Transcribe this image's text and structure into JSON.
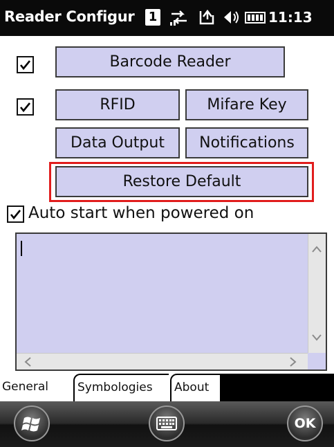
{
  "window": {
    "title": "Reader Configur",
    "badge": "1",
    "clock": "11:13",
    "status_icons": [
      "connectivity-icon",
      "sync-icon",
      "volume-icon",
      "battery-icon"
    ]
  },
  "buttons": {
    "barcode_reader": "Barcode Reader",
    "rfid": "RFID",
    "mifare_key": "Mifare Key",
    "data_output": "Data Output",
    "notifications": "Notifications",
    "restore_default": "Restore Default"
  },
  "checkboxes": {
    "barcode_enabled": true,
    "rfid_enabled": true,
    "auto_start_checked": true,
    "auto_start_label": "Auto start when powered on"
  },
  "log_area": {
    "value": ""
  },
  "tabs": [
    {
      "label": "General",
      "active": true
    },
    {
      "label": "Symbologies",
      "active": false
    },
    {
      "label": "About",
      "active": false
    }
  ],
  "taskbar": {
    "start_icon": "windows-start-icon",
    "keyboard_icon": "keyboard-icon",
    "ok_label": "OK"
  },
  "colors": {
    "button_fill": "#d0cff0",
    "highlight_border": "#e11d1d",
    "titlebar": "#0a0a0a"
  }
}
